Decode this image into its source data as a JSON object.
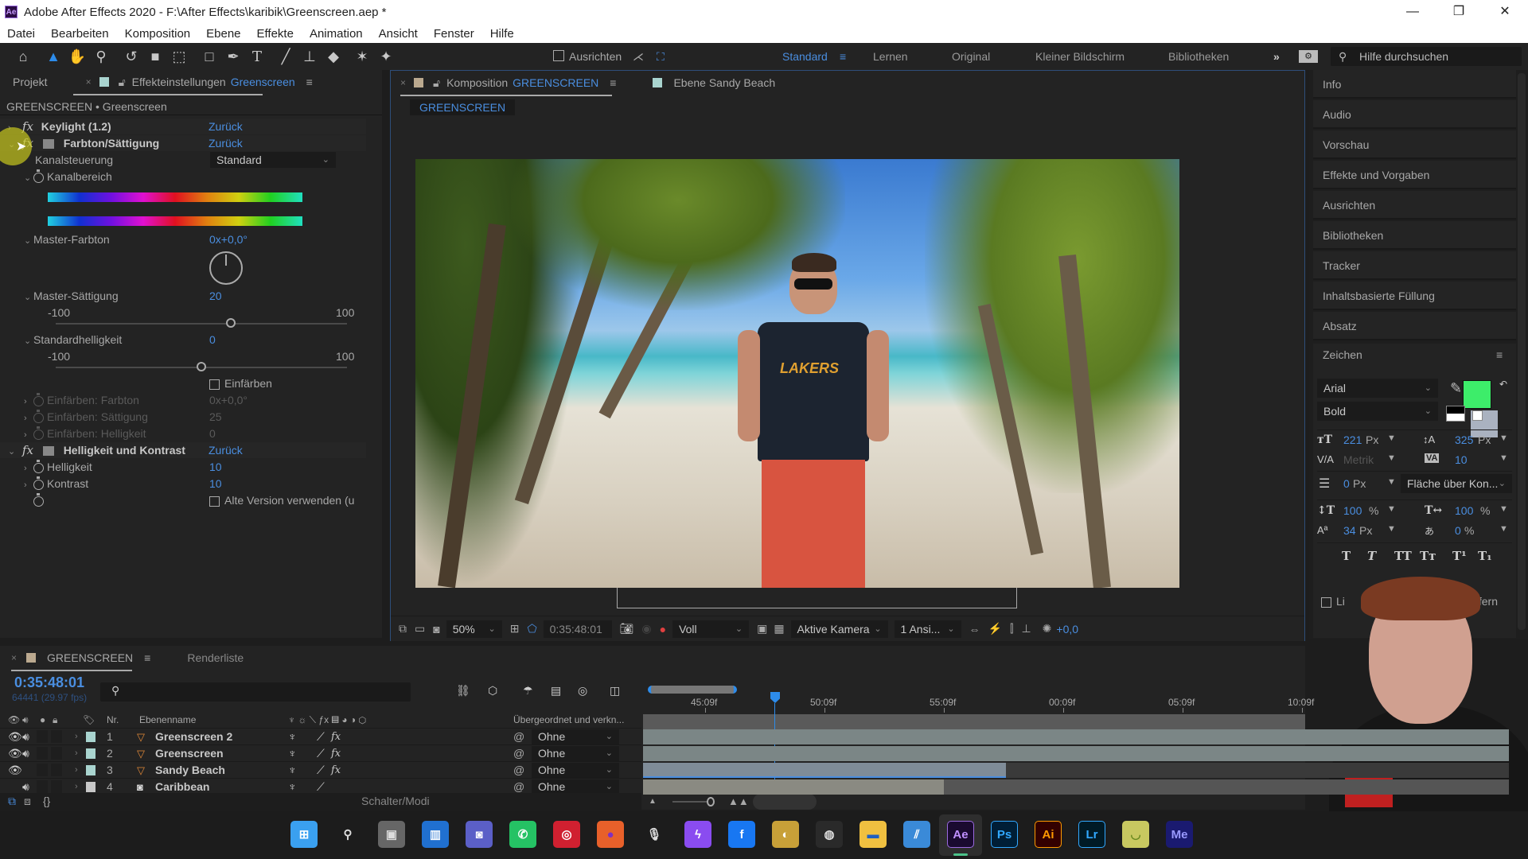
{
  "window": {
    "title": "Adobe After Effects 2020 - F:\\After Effects\\karibik\\Greenscreen.aep *",
    "app_logo": "Ae",
    "controls": [
      "—",
      "❐",
      "✕"
    ]
  },
  "menu": [
    "Datei",
    "Bearbeiten",
    "Komposition",
    "Ebene",
    "Effekte",
    "Animation",
    "Ansicht",
    "Fenster",
    "Hilfe"
  ],
  "toolbar": {
    "tools": [
      "home-icon",
      "selection-icon",
      "hand-icon",
      "zoom-icon",
      "rotate-icon",
      "camera-icon",
      "pan-behind-icon",
      "rectangle-icon",
      "pen-icon",
      "text-icon",
      "brush-icon",
      "clone-stamp-icon",
      "eraser-icon",
      "roto-brush-icon",
      "puppet-pin-icon"
    ],
    "snap_label": "Ausrichten",
    "workspaces": [
      "Standard",
      "Lernen",
      "Original",
      "Kleiner Bildschirm",
      "Bibliotheken"
    ],
    "active_workspace": "Standard",
    "more": "»",
    "help_placeholder": "Hilfe durchsuchen"
  },
  "effects_panel": {
    "tab_project": "Projekt",
    "tab_effects": "Effekteinstellungen",
    "tab_effects_layer": "Greenscreen",
    "breadcrumb": "GREENSCREEN • Greenscreen",
    "effects": [
      {
        "name": "Keylight (1.2)",
        "reset": "Zurück",
        "expanded": false
      },
      {
        "name": "Farbton/Sättigung",
        "reset": "Zurück",
        "expanded": true
      },
      {
        "name": "Helligkeit und Kontrast",
        "reset": "Zurück",
        "expanded": true
      }
    ],
    "hue_sat": {
      "channel_control_label": "Kanalsteuerung",
      "channel_control_value": "Standard",
      "channel_range_label": "Kanalbereich",
      "master_hue_label": "Master-Farbton",
      "master_hue_value": "0x+0,0°",
      "master_sat_label": "Master-Sättigung",
      "master_sat_value": "20",
      "master_sat_min": "-100",
      "master_sat_max": "100",
      "master_sat_fraction": 0.6,
      "lightness_label": "Standardhelligkeit",
      "lightness_value": "0",
      "lightness_min": "-100",
      "lightness_max": "100",
      "lightness_fraction": 0.5,
      "colorize_label": "Einfärben",
      "colorize_checked": false,
      "colorize_hue_label": "Einfärben: Farbton",
      "colorize_hue_value": "0x+0,0°",
      "colorize_sat_label": "Einfärben: Sättigung",
      "colorize_sat_value": "25",
      "colorize_light_label": "Einfärben: Helligkeit",
      "colorize_light_value": "0"
    },
    "brightness_contrast": {
      "brightness_label": "Helligkeit",
      "brightness_value": "10",
      "contrast_label": "Kontrast",
      "contrast_value": "10",
      "legacy_label": "Alte Version verwenden (u",
      "legacy_checked": false
    }
  },
  "comp_panel": {
    "tab_prefix": "Komposition",
    "tab_comp": "GREENSCREEN",
    "tab_layer": "Ebene Sandy Beach",
    "breadcrumb": "GREENSCREEN",
    "zoom": "50%",
    "timecode": "0:35:48:01",
    "resolution": "Voll",
    "camera": "Aktive Kamera",
    "views": "1 Ansi...",
    "exposure": "+0,0"
  },
  "right_panel": {
    "items": [
      "Info",
      "Audio",
      "Vorschau",
      "Effekte und Vorgaben",
      "Ausrichten",
      "Bibliotheken",
      "Tracker",
      "Inhaltsbasierte Füllung",
      "Absatz"
    ],
    "character": {
      "title": "Zeichen",
      "font": "Arial",
      "style": "Bold",
      "fill_color": "#3ded6a",
      "size_value": "221",
      "size_unit": "Px",
      "leading_value": "325",
      "leading_unit": "Px",
      "kerning_value": "Metrik",
      "tracking_value": "10",
      "stroke_value": "0",
      "stroke_unit": "Px",
      "stroke_mode": "Fläche über Kon...",
      "vscale_value": "100",
      "vscale_unit": "%",
      "hscale_value": "100",
      "hscale_unit": "%",
      "baseline_value": "34",
      "baseline_unit": "Px",
      "tsume_value": "0",
      "tsume_unit": "%",
      "styles": [
        "T",
        "T",
        "TT",
        "Tт",
        "T¹",
        "T₁"
      ],
      "ligatures_label": "Li",
      "hindi_label": "Hindi-Ziffern"
    }
  },
  "timeline": {
    "tab_comp": "GREENSCREEN",
    "tab_render": "Renderliste",
    "timecode": "0:35:48:01",
    "frame_info": "64441 (29.97 fps)",
    "columns": {
      "nr": "Nr.",
      "name": "Ebenenname",
      "parent": "Übergeordnet und verkn..."
    },
    "layers": [
      {
        "nr": "1",
        "name": "Greenscreen 2",
        "type": "precomp",
        "video": true,
        "audio": true,
        "fx": true,
        "parent": "Ohne",
        "label_color": "#a9d4cf"
      },
      {
        "nr": "2",
        "name": "Greenscreen",
        "type": "precomp",
        "video": true,
        "audio": true,
        "fx": true,
        "parent": "Ohne",
        "label_color": "#a9d4cf"
      },
      {
        "nr": "3",
        "name": "Sandy Beach",
        "type": "precomp",
        "video": true,
        "audio": false,
        "fx": true,
        "parent": "Ohne",
        "label_color": "#a9d4cf"
      },
      {
        "nr": "4",
        "name": "Caribbean",
        "type": "audio",
        "video": false,
        "audio": true,
        "fx": false,
        "parent": "Ohne",
        "label_color": "#c8c8c8"
      }
    ],
    "ruler": [
      "45:09f",
      "50:09f",
      "55:09f",
      "00:09f",
      "05:09f",
      "10:09f"
    ],
    "switches_label": "Schalter/Modi"
  },
  "taskbar": {
    "apps": [
      "start",
      "search",
      "task-view",
      "widgets",
      "teams",
      "whatsapp",
      "cast",
      "firefox",
      "podcast",
      "messenger",
      "facebook",
      "photo",
      "obs",
      "explorer",
      "vscode-like",
      "Ae",
      "Ps",
      "Ai",
      "Lr",
      "cup",
      "Me"
    ]
  }
}
